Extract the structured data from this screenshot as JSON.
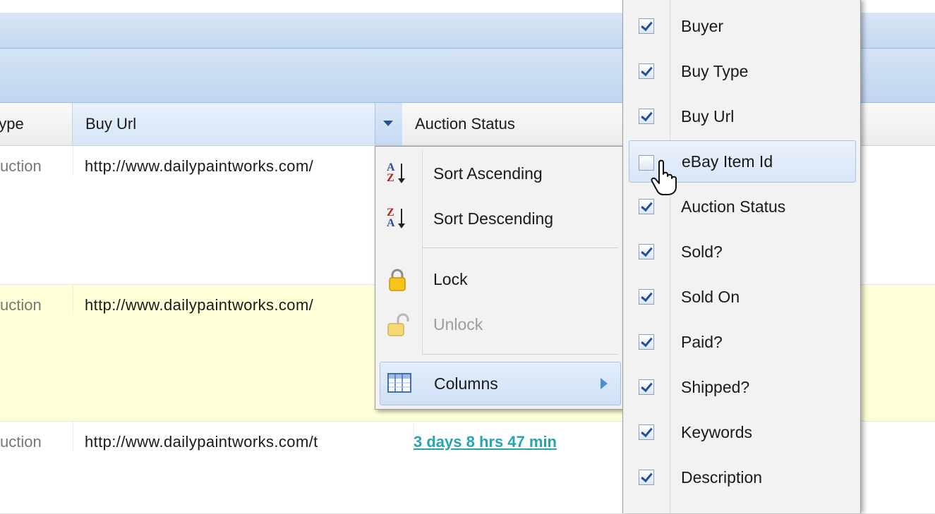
{
  "grid": {
    "columns": {
      "type": "Type",
      "buy_url": "Buy Url",
      "auction_status": "Auction Status"
    },
    "rows": [
      {
        "type": "uction",
        "buy_url": "http://www.dailypaintworks.com/",
        "auction_status": ""
      },
      {
        "type": "uction",
        "buy_url": "http://www.dailypaintworks.com/",
        "auction_status": ""
      },
      {
        "type": "uction",
        "buy_url": "http://www.dailypaintworks.com/t",
        "auction_status": "3 days 8 hrs 47 min"
      }
    ]
  },
  "column_menu": {
    "sort_ascending": "Sort Ascending",
    "sort_descending": "Sort Descending",
    "lock": "Lock",
    "unlock": "Unlock",
    "columns": "Columns"
  },
  "columns_submenu": {
    "items": [
      {
        "label": "Buyer",
        "checked": true
      },
      {
        "label": "Buy Type",
        "checked": true
      },
      {
        "label": "Buy Url",
        "checked": true
      },
      {
        "label": "eBay Item Id",
        "checked": false
      },
      {
        "label": "Auction Status",
        "checked": true
      },
      {
        "label": "Sold?",
        "checked": true
      },
      {
        "label": "Sold On",
        "checked": true
      },
      {
        "label": "Paid?",
        "checked": true
      },
      {
        "label": "Shipped?",
        "checked": true
      },
      {
        "label": "Keywords",
        "checked": true
      },
      {
        "label": "Description",
        "checked": true
      }
    ]
  },
  "colors": {
    "header_blue": "#c4d8f0",
    "row_highlight": "#ffffd8",
    "link_teal": "#2aa3b0",
    "menu_bg": "#f2f2f2"
  }
}
